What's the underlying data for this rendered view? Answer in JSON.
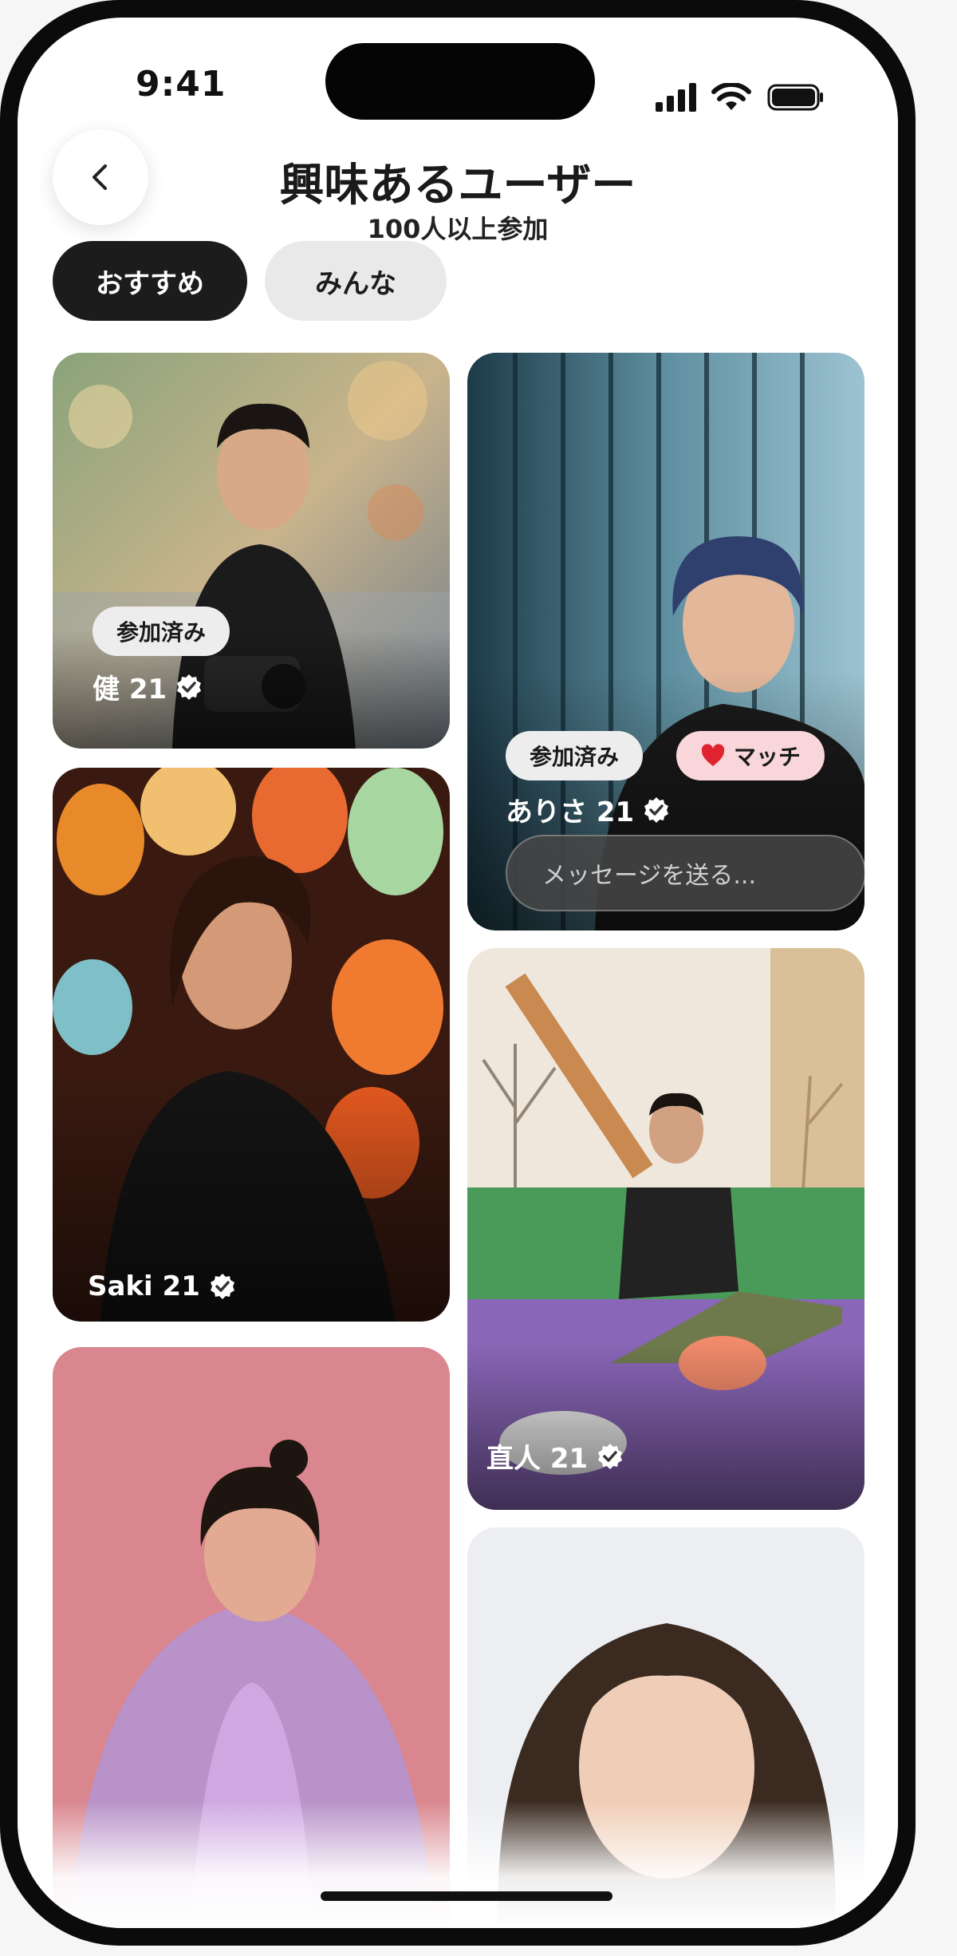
{
  "status_bar": {
    "time": "9:41"
  },
  "header": {
    "title": "興味あるユーザー",
    "subtitle": "100人以上参加"
  },
  "tabs": [
    {
      "label": "おすすめ",
      "active": true
    },
    {
      "label": "みんな",
      "active": false
    }
  ],
  "cards": [
    {
      "name": "健 21",
      "chip": "参加済み",
      "verified": true
    },
    {
      "name": "ありさ 21",
      "chip": "参加済み",
      "match_label": "マッチ",
      "message_placeholder": "メッセージを送る...",
      "verified": true
    },
    {
      "name": "Saki 21",
      "verified": true
    },
    {
      "name": "直人 21",
      "verified": true
    },
    {
      "name": ""
    },
    {
      "name": ""
    }
  ],
  "colors": {
    "accent_dark": "#1c1c1c",
    "match_heart": "#e0242f",
    "match_chip_bg": "#f8d6da"
  },
  "icons": [
    "back-chevron-icon",
    "signal-icon",
    "wifi-icon",
    "battery-icon",
    "verified-badge-icon",
    "heart-icon"
  ]
}
